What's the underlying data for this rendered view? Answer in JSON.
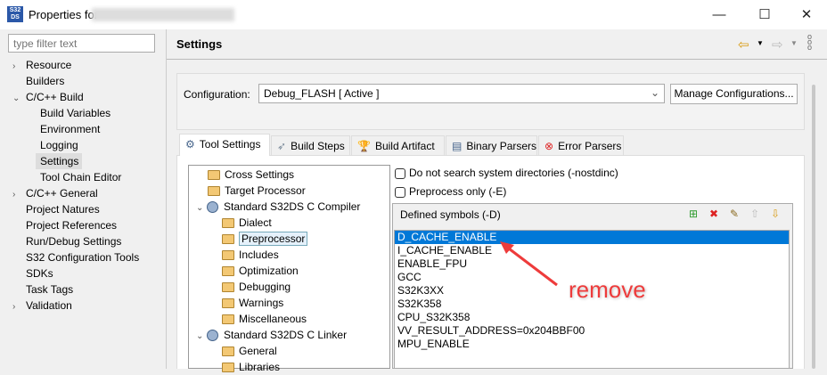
{
  "window": {
    "title": "Properties for",
    "minimize": "—",
    "maximize": "☐",
    "close": "✕"
  },
  "filter": {
    "placeholder": "type filter text"
  },
  "nav_tree": [
    {
      "label": "Resource",
      "chevron": "›",
      "indent": 0
    },
    {
      "label": "Builders",
      "indent": 0
    },
    {
      "label": "C/C++ Build",
      "chevron": "⌄",
      "indent": 0
    },
    {
      "label": "Build Variables",
      "indent": 1
    },
    {
      "label": "Environment",
      "indent": 1
    },
    {
      "label": "Logging",
      "indent": 1
    },
    {
      "label": "Settings",
      "indent": 1,
      "selected": true
    },
    {
      "label": "Tool Chain Editor",
      "indent": 1
    },
    {
      "label": "C/C++ General",
      "chevron": "›",
      "indent": 0
    },
    {
      "label": "Project Natures",
      "indent": 0
    },
    {
      "label": "Project References",
      "indent": 0
    },
    {
      "label": "Run/Debug Settings",
      "indent": 0
    },
    {
      "label": "S32 Configuration Tools",
      "indent": 0
    },
    {
      "label": "SDKs",
      "indent": 0
    },
    {
      "label": "Task Tags",
      "indent": 0
    },
    {
      "label": "Validation",
      "chevron": "›",
      "indent": 0
    }
  ],
  "page": {
    "title": "Settings",
    "configuration_label": "Configuration:",
    "configuration_value": "Debug_FLASH  [ Active ]",
    "manage_button": "Manage Configurations..."
  },
  "tabs": [
    {
      "label": "Tool Settings",
      "active": true
    },
    {
      "label": "Build Steps"
    },
    {
      "label": "Build Artifact"
    },
    {
      "label": "Binary Parsers"
    },
    {
      "label": "Error Parsers"
    }
  ],
  "tool_tree": [
    {
      "label": "Cross Settings",
      "type": "folder",
      "level": 0
    },
    {
      "label": "Target Processor",
      "type": "folder",
      "level": 0
    },
    {
      "label": "Standard S32DS C Compiler",
      "type": "tool",
      "level": 0,
      "chevron": "⌄"
    },
    {
      "label": "Dialect",
      "type": "folder",
      "level": 1
    },
    {
      "label": "Preprocessor",
      "type": "folder",
      "level": 1,
      "selected": true
    },
    {
      "label": "Includes",
      "type": "folder",
      "level": 1
    },
    {
      "label": "Optimization",
      "type": "folder",
      "level": 1
    },
    {
      "label": "Debugging",
      "type": "folder",
      "level": 1
    },
    {
      "label": "Warnings",
      "type": "folder",
      "level": 1
    },
    {
      "label": "Miscellaneous",
      "type": "folder",
      "level": 1
    },
    {
      "label": "Standard S32DS C Linker",
      "type": "tool",
      "level": 0,
      "chevron": "⌄"
    },
    {
      "label": "General",
      "type": "folder",
      "level": 1
    },
    {
      "label": "Libraries",
      "type": "folder",
      "level": 1
    }
  ],
  "options": {
    "nostdinc": "Do not search system directories (-nostdinc)",
    "preprocess_only": "Preprocess only (-E)"
  },
  "symbols": {
    "title": "Defined symbols (-D)",
    "items": [
      "D_CACHE_ENABLE",
      "I_CACHE_ENABLE",
      "ENABLE_FPU",
      "GCC",
      "S32K3XX",
      "S32K358",
      "CPU_S32K358",
      "VV_RESULT_ADDRESS=0x204BBF00",
      "MPU_ENABLE"
    ],
    "selected_index": 0
  },
  "annotation": {
    "text": "remove",
    "color": "#ee3b3b"
  }
}
